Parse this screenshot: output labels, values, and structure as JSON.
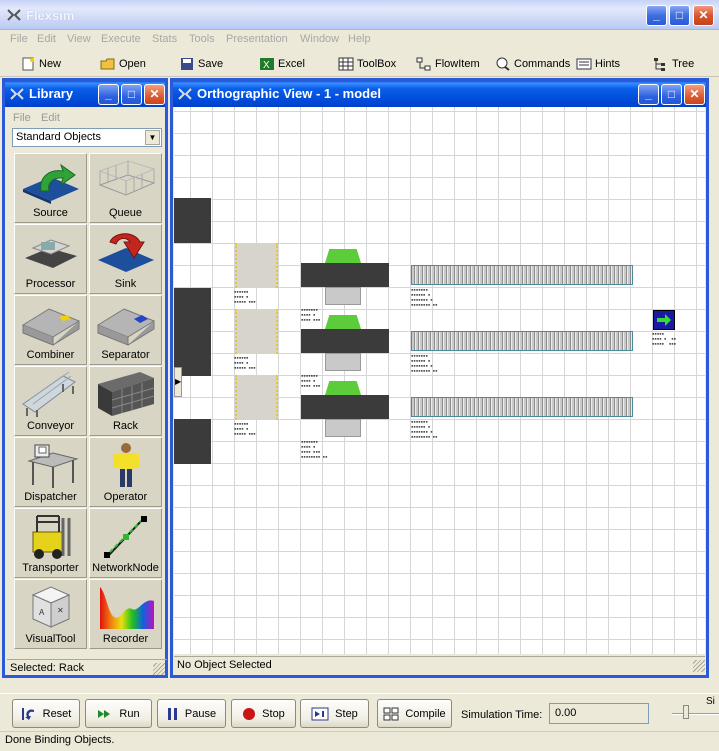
{
  "app": {
    "title": "Flexsim",
    "status": "Done Binding Objects."
  },
  "menu": [
    "File",
    "Edit",
    "View",
    "Execute",
    "Stats",
    "Tools",
    "Presentation",
    "Window",
    "Help"
  ],
  "toolbar": {
    "new": "New",
    "open": "Open",
    "save": "Save",
    "excel": "Excel",
    "toolbox": "ToolBox",
    "flowitem": "FlowItem",
    "commands": "Commands",
    "hints": "Hints",
    "tree": "Tree"
  },
  "library": {
    "title": "Library",
    "menu": [
      "File",
      "Edit"
    ],
    "category": "Standard Objects",
    "items": [
      "Source",
      "Queue",
      "Processor",
      "Sink",
      "Combiner",
      "Separator",
      "Conveyor",
      "Rack",
      "Dispatcher",
      "Operator",
      "Transporter",
      "NetworkNode",
      "VisualTool",
      "Recorder"
    ],
    "status": "Selected: Rack"
  },
  "ortho": {
    "title": "Orthographic View - 1 - model",
    "status": "No Object Selected"
  },
  "controls": {
    "reset": "Reset",
    "run": "Run",
    "pause": "Pause",
    "stop": "Stop",
    "step": "Step",
    "compile": "Compile",
    "sim_time_label": "Simulation Time:",
    "sim_time_value": "0.00",
    "speed_label": "Si"
  },
  "colors": {
    "titlebar_active": "#0a5ee8",
    "window_border": "#2c5ad7",
    "chrome": "#ece9d8",
    "processor_green": "#5ccc3a",
    "sink_blue": "#1a1aa0"
  }
}
